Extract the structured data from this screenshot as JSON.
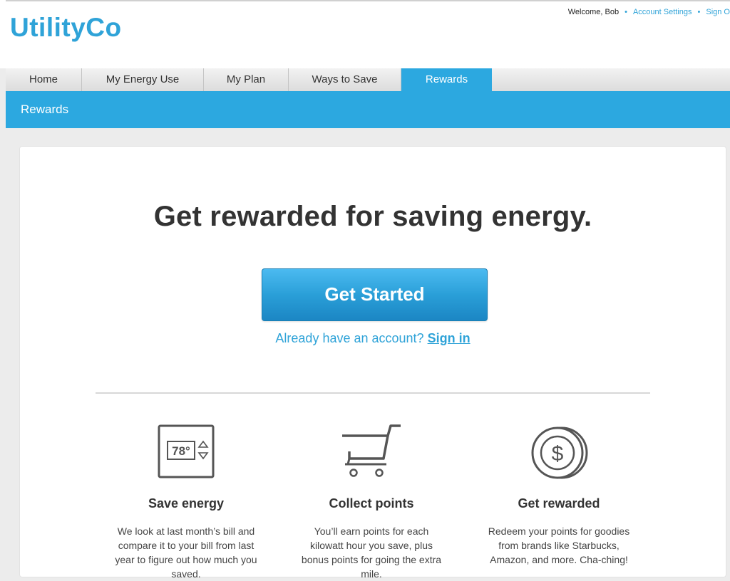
{
  "header": {
    "logo": "UtilityCo",
    "welcome": "Welcome, Bob",
    "account_settings": "Account Settings",
    "sign_out": "Sign O"
  },
  "nav": {
    "tabs": [
      {
        "label": "Home"
      },
      {
        "label": "My Energy Use"
      },
      {
        "label": "My Plan"
      },
      {
        "label": "Ways to Save"
      },
      {
        "label": "Rewards"
      }
    ],
    "active": "Rewards"
  },
  "subnav": {
    "title": "Rewards"
  },
  "hero": {
    "headline": "Get rewarded for saving energy.",
    "cta": "Get Started",
    "account_prompt": "Already have an account?",
    "signin": "Sign in"
  },
  "features": [
    {
      "icon": "thermostat-icon",
      "thermostat_reading": "78°",
      "title": "Save energy",
      "description": "We look at last month’s bill and compare it to your bill from last year to figure out how much you saved."
    },
    {
      "icon": "shopping-cart-icon",
      "title": "Collect points",
      "description": "You’ll earn points for each kilowatt hour you save, plus bonus points for going the extra mile."
    },
    {
      "icon": "dollar-coin-icon",
      "coin_symbol": "$",
      "title": "Get rewarded",
      "description": "Redeem your points for goodies from brands like Starbucks, Amazon, and more. Cha-ching!"
    }
  ],
  "colors": {
    "brand": "#2fa3d8",
    "nav_active": "#2ca8e0",
    "text": "#333333"
  }
}
